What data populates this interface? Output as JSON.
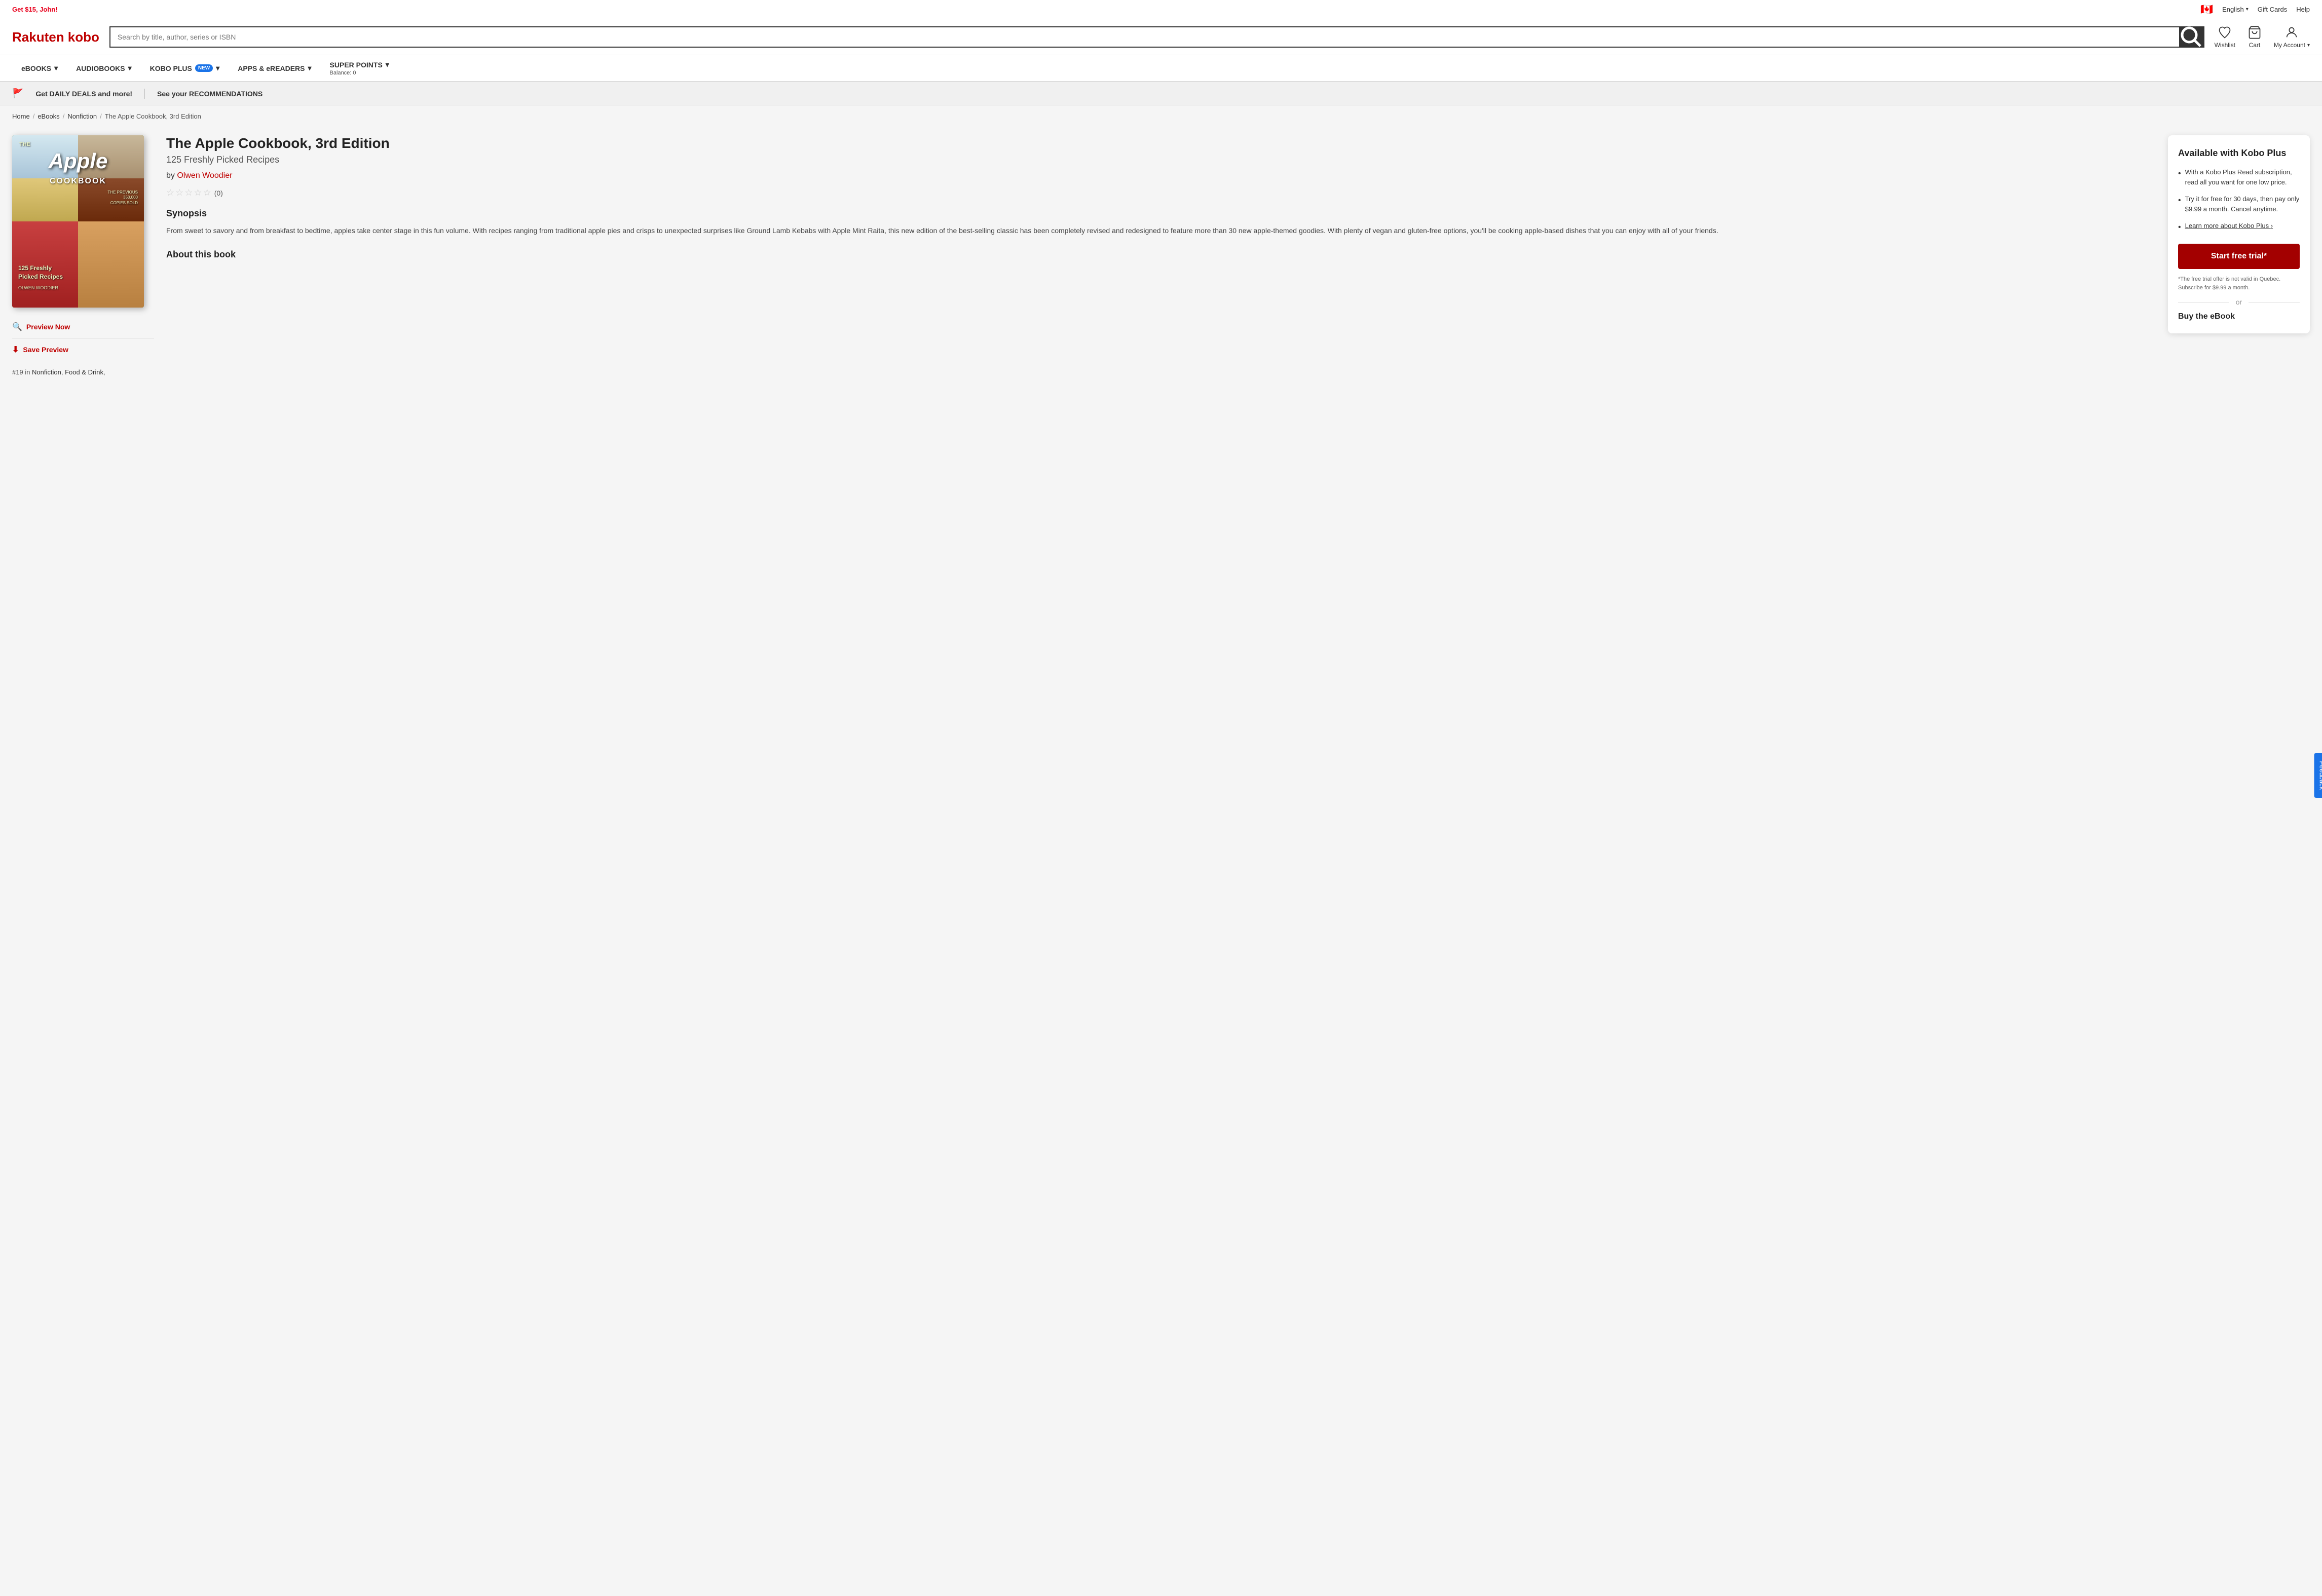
{
  "topbar": {
    "promo": "Get $15, John!",
    "flag": "🇨🇦",
    "english_label": "English",
    "gift_cards_label": "Gift Cards",
    "help_label": "Help"
  },
  "header": {
    "logo_rakuten": "Rakuten",
    "logo_kobo": " kobo",
    "search_placeholder": "Search by title, author, series or ISBN",
    "search_button_icon": "🔍",
    "wishlist_label": "Wishlist",
    "cart_label": "Cart",
    "my_account_label": "My Account"
  },
  "nav": {
    "items": [
      {
        "label": "eBOOKS",
        "has_chevron": true
      },
      {
        "label": "AUDIOBOOKS",
        "has_chevron": true
      },
      {
        "label": "KOBO PLUS",
        "badge": "NEW",
        "has_chevron": true
      },
      {
        "label": "APPS & eREADERS",
        "has_chevron": true
      },
      {
        "label": "SUPER POINTS",
        "has_chevron": true,
        "sub": "Balance: 0"
      }
    ]
  },
  "deals_bar": {
    "flag_icon": "🚩",
    "deals_text": "Get DAILY DEALS and more!",
    "recommendations_text": "See your RECOMMENDATIONS"
  },
  "breadcrumb": {
    "home": "Home",
    "ebooks": "eBooks",
    "nonfiction": "Nonfiction",
    "current": "The Apple Cookbook, 3rd Edition"
  },
  "book": {
    "title": "The Apple Cookbook, 3rd Edition",
    "subtitle": "125 Freshly Picked Recipes",
    "author_prefix": "by",
    "author_name": "Olwen Woodier",
    "rating_count": "(0)",
    "synopsis_heading": "Synopsis",
    "synopsis_text": "From sweet to savory and from breakfast to bedtime, apples take center stage in this fun volume. With recipes ranging from traditional apple pies and crisps to unexpected surprises like Ground Lamb Kebabs with Apple Mint Raita, this new edition of the best-selling classic has been completely revised and redesigned to feature more than 30 new apple-themed goodies. With plenty of vegan and gluten-free options, you'll be cooking apple-based dishes that you can enjoy with all of your friends.",
    "about_heading": "About this book",
    "preview_label": "Preview Now",
    "save_preview_label": "Save Preview",
    "ranking_text": "#19 in",
    "ranking_cat1": "Nonfiction",
    "ranking_cat2": "Food & Drink",
    "cover_title": "Apple",
    "cover_book_title": "COOKBOOK",
    "cover_series": "THE",
    "cover_freshly": "125 Freshly\nPicked Recipes",
    "cover_author": "OLWEN WOODIER"
  },
  "kobo_plus": {
    "card_title": "Available with Kobo Plus",
    "bullet1": "With a Kobo Plus Read subscription, read all you want for one low price.",
    "bullet2": "Try it for free for 30 days, then pay only $9.99 a month. Cancel anytime.",
    "learn_more_text": "Learn more about Kobo Plus",
    "learn_more_arrow": "›",
    "trial_button": "Start free trial*",
    "footnote": "*The free trial offer is not valid in Quebec. Subscribe for $9.99 a month.",
    "or_text": "or",
    "buy_ebook_label": "Buy the eBook"
  },
  "feedback": {
    "label": "Feedback"
  }
}
